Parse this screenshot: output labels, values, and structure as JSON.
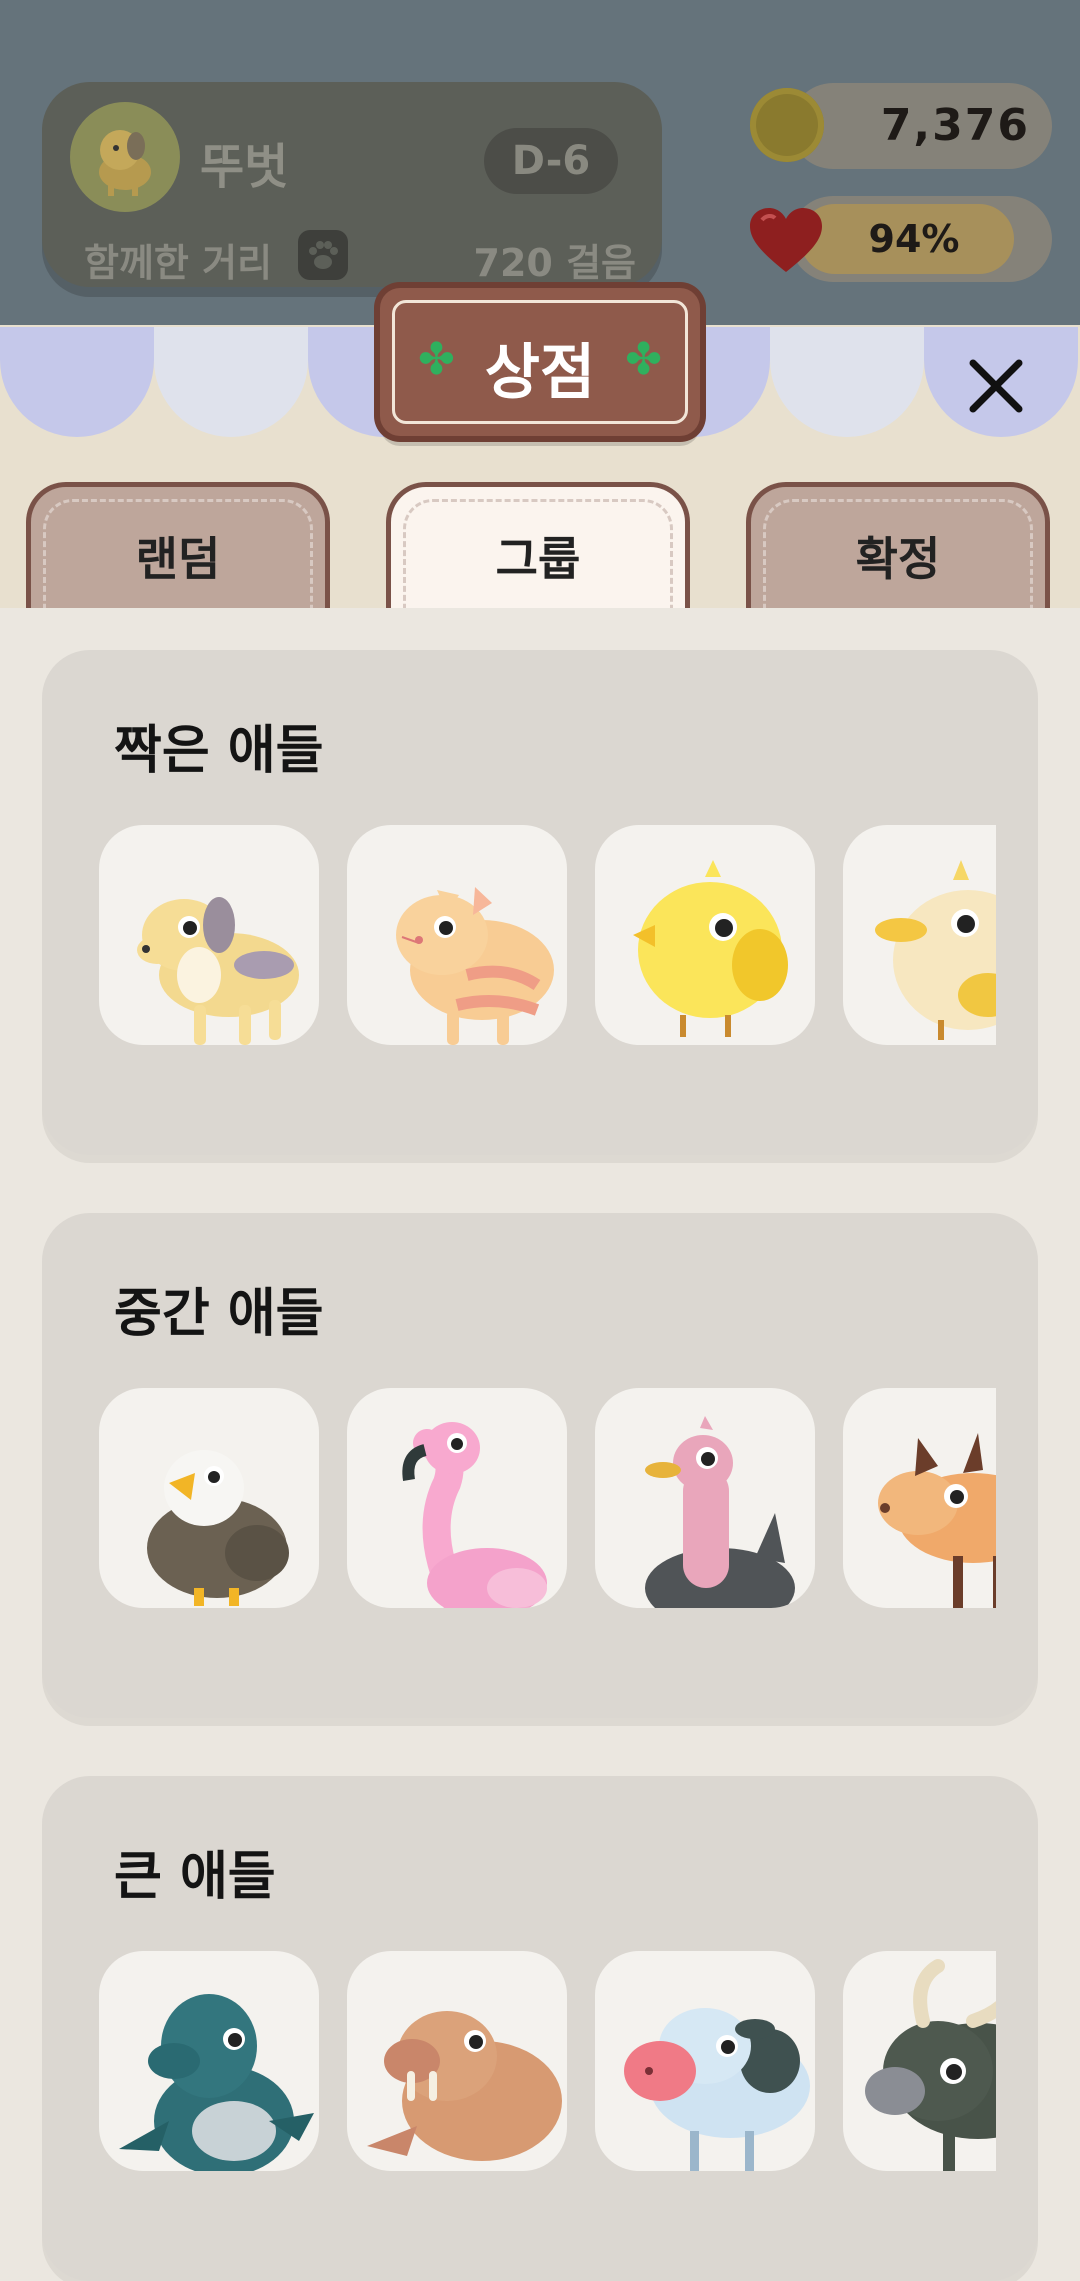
{
  "status": {
    "pet_name": "뚜벗",
    "dday": "D-6",
    "distance_label": "함께한 거리",
    "steps": "720 걸음",
    "coins": "7,376",
    "health": "94%",
    "health_value": 0.94
  },
  "shop": {
    "title": "상점",
    "close_icon": "close-icon"
  },
  "tabs": [
    {
      "label": "랜덤",
      "active": false
    },
    {
      "label": "그룹",
      "active": true
    },
    {
      "label": "확정",
      "active": false
    }
  ],
  "groups": [
    {
      "title": "짝은 애들",
      "animals": [
        "dog",
        "cat",
        "chick",
        "duck"
      ]
    },
    {
      "title": "중간 애들",
      "animals": [
        "eagle",
        "flamingo",
        "ostrich",
        "deer"
      ]
    },
    {
      "title": "큰 애들",
      "animals": [
        "seal",
        "walrus",
        "cow",
        "bull"
      ]
    }
  ],
  "colors": {
    "topbar": "#65737b",
    "shop_sign": "#8f5a4b",
    "active_tab": "#fbf4ee",
    "inactive_tab": "#bea69b",
    "card": "#dbd7d1"
  }
}
